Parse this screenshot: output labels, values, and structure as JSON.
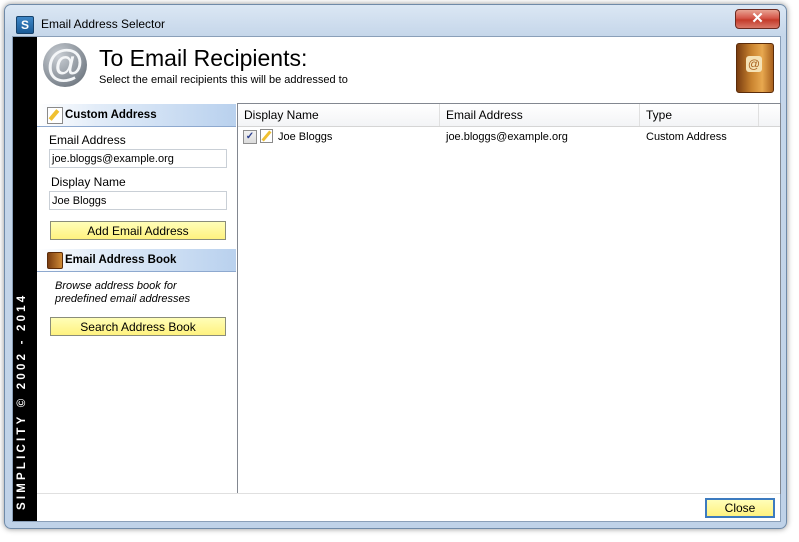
{
  "window": {
    "title": "Email Address Selector",
    "app_icon_letter": "S",
    "close_glyph": "✕"
  },
  "sidebar": {
    "vertical_text": "SIMPLICITY © 2002 - 2014"
  },
  "header": {
    "title": "To Email Recipients:",
    "subtitle": "Select the email recipients this will be addressed to"
  },
  "custom_address": {
    "section_label": "Custom Address",
    "email_label": "Email Address",
    "email_value": "joe.bloggs@example.org",
    "display_label": "Display Name",
    "display_value": "Joe Bloggs",
    "add_button": "Add Email Address"
  },
  "address_book": {
    "section_label": "Email Address Book",
    "note_line1": "Browse address book for",
    "note_line2": "predefined email addresses",
    "search_button": "Search Address Book"
  },
  "grid": {
    "columns": [
      "Display Name",
      "Email Address",
      "Type"
    ],
    "rows": [
      {
        "checked": "✓",
        "display_name": "Joe Bloggs",
        "email": "joe.bloggs@example.org",
        "type": "Custom Address"
      }
    ]
  },
  "footer": {
    "close_button": "Close"
  },
  "icons": {
    "app": "simplicity-icon",
    "header": "at-sign-icon",
    "book": "address-book-icon",
    "pencil": "pencil-note-icon"
  }
}
